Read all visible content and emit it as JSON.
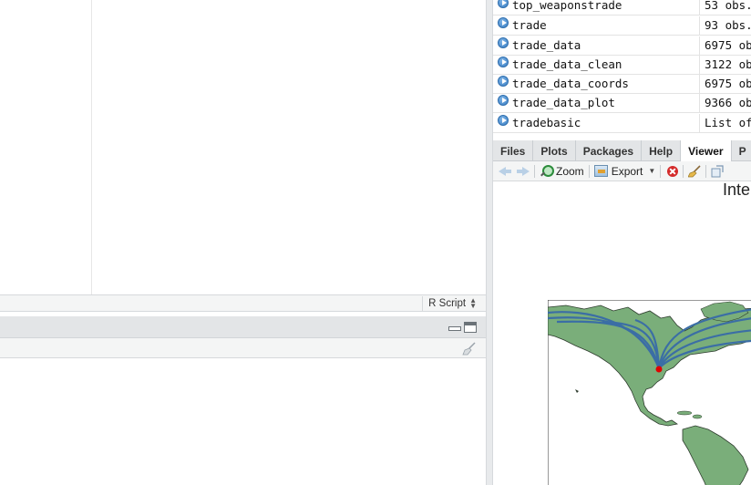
{
  "editor": {
    "file_type": "R Script"
  },
  "environment": {
    "rows": [
      {
        "name": "top_weaponstrade",
        "value": "53 obs."
      },
      {
        "name": "trade",
        "value": "93 obs."
      },
      {
        "name": "trade_data",
        "value": "6975 ob"
      },
      {
        "name": "trade_data_clean",
        "value": "3122 ob"
      },
      {
        "name": "trade_data_coords",
        "value": "6975 ob"
      },
      {
        "name": "trade_data_plot",
        "value": "9366 ob"
      },
      {
        "name": "tradebasic",
        "value": "List of"
      }
    ]
  },
  "tabs": [
    {
      "label": "Files",
      "active": false
    },
    {
      "label": "Plots",
      "active": false
    },
    {
      "label": "Packages",
      "active": false
    },
    {
      "label": "Help",
      "active": false
    },
    {
      "label": "Viewer",
      "active": true
    },
    {
      "label": "P",
      "active": false
    }
  ],
  "viewer_toolbar": {
    "zoom_label": "Zoom",
    "export_label": "Export"
  },
  "viewer": {
    "title_fragment": "Inte"
  },
  "icons": {
    "back": "back-arrow-icon",
    "forward": "forward-arrow-icon",
    "zoom": "zoom-magnifier-icon",
    "export": "export-icon",
    "close": "close-red-icon",
    "broom": "broom-clear-icon",
    "popout": "popout-icon"
  },
  "colors": {
    "land": "#7aae7a",
    "route": "#3b6ea5",
    "origin_point": "#e00000",
    "active_tab": "#ffffff",
    "pane_header": "#e3e5e7"
  }
}
